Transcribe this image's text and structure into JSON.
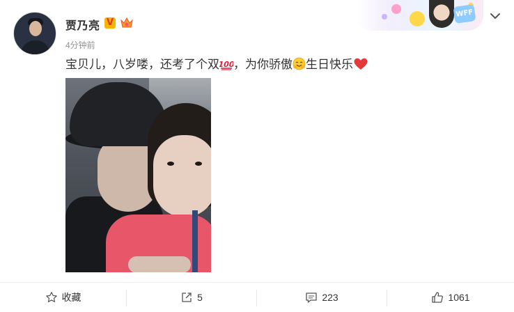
{
  "post": {
    "username": "贾乃亮",
    "verified_badge": "V",
    "time": "4分钟前",
    "text_segments": [
      "宝贝儿，八岁喽，还考了个双",
      "，为你骄傲",
      "生日快乐"
    ],
    "emojis": [
      "hundred-points-emoji",
      "hug-emoji",
      "heart-emoji"
    ],
    "photo_alt": ""
  },
  "banner": {
    "label": "WFF"
  },
  "actions": {
    "favorite_label": "收藏",
    "share_count": "5",
    "comment_count": "223",
    "like_count": "1061"
  },
  "colors": {
    "heart": "#e23a3a",
    "accent": "#f7b500",
    "muted": "#939393"
  }
}
